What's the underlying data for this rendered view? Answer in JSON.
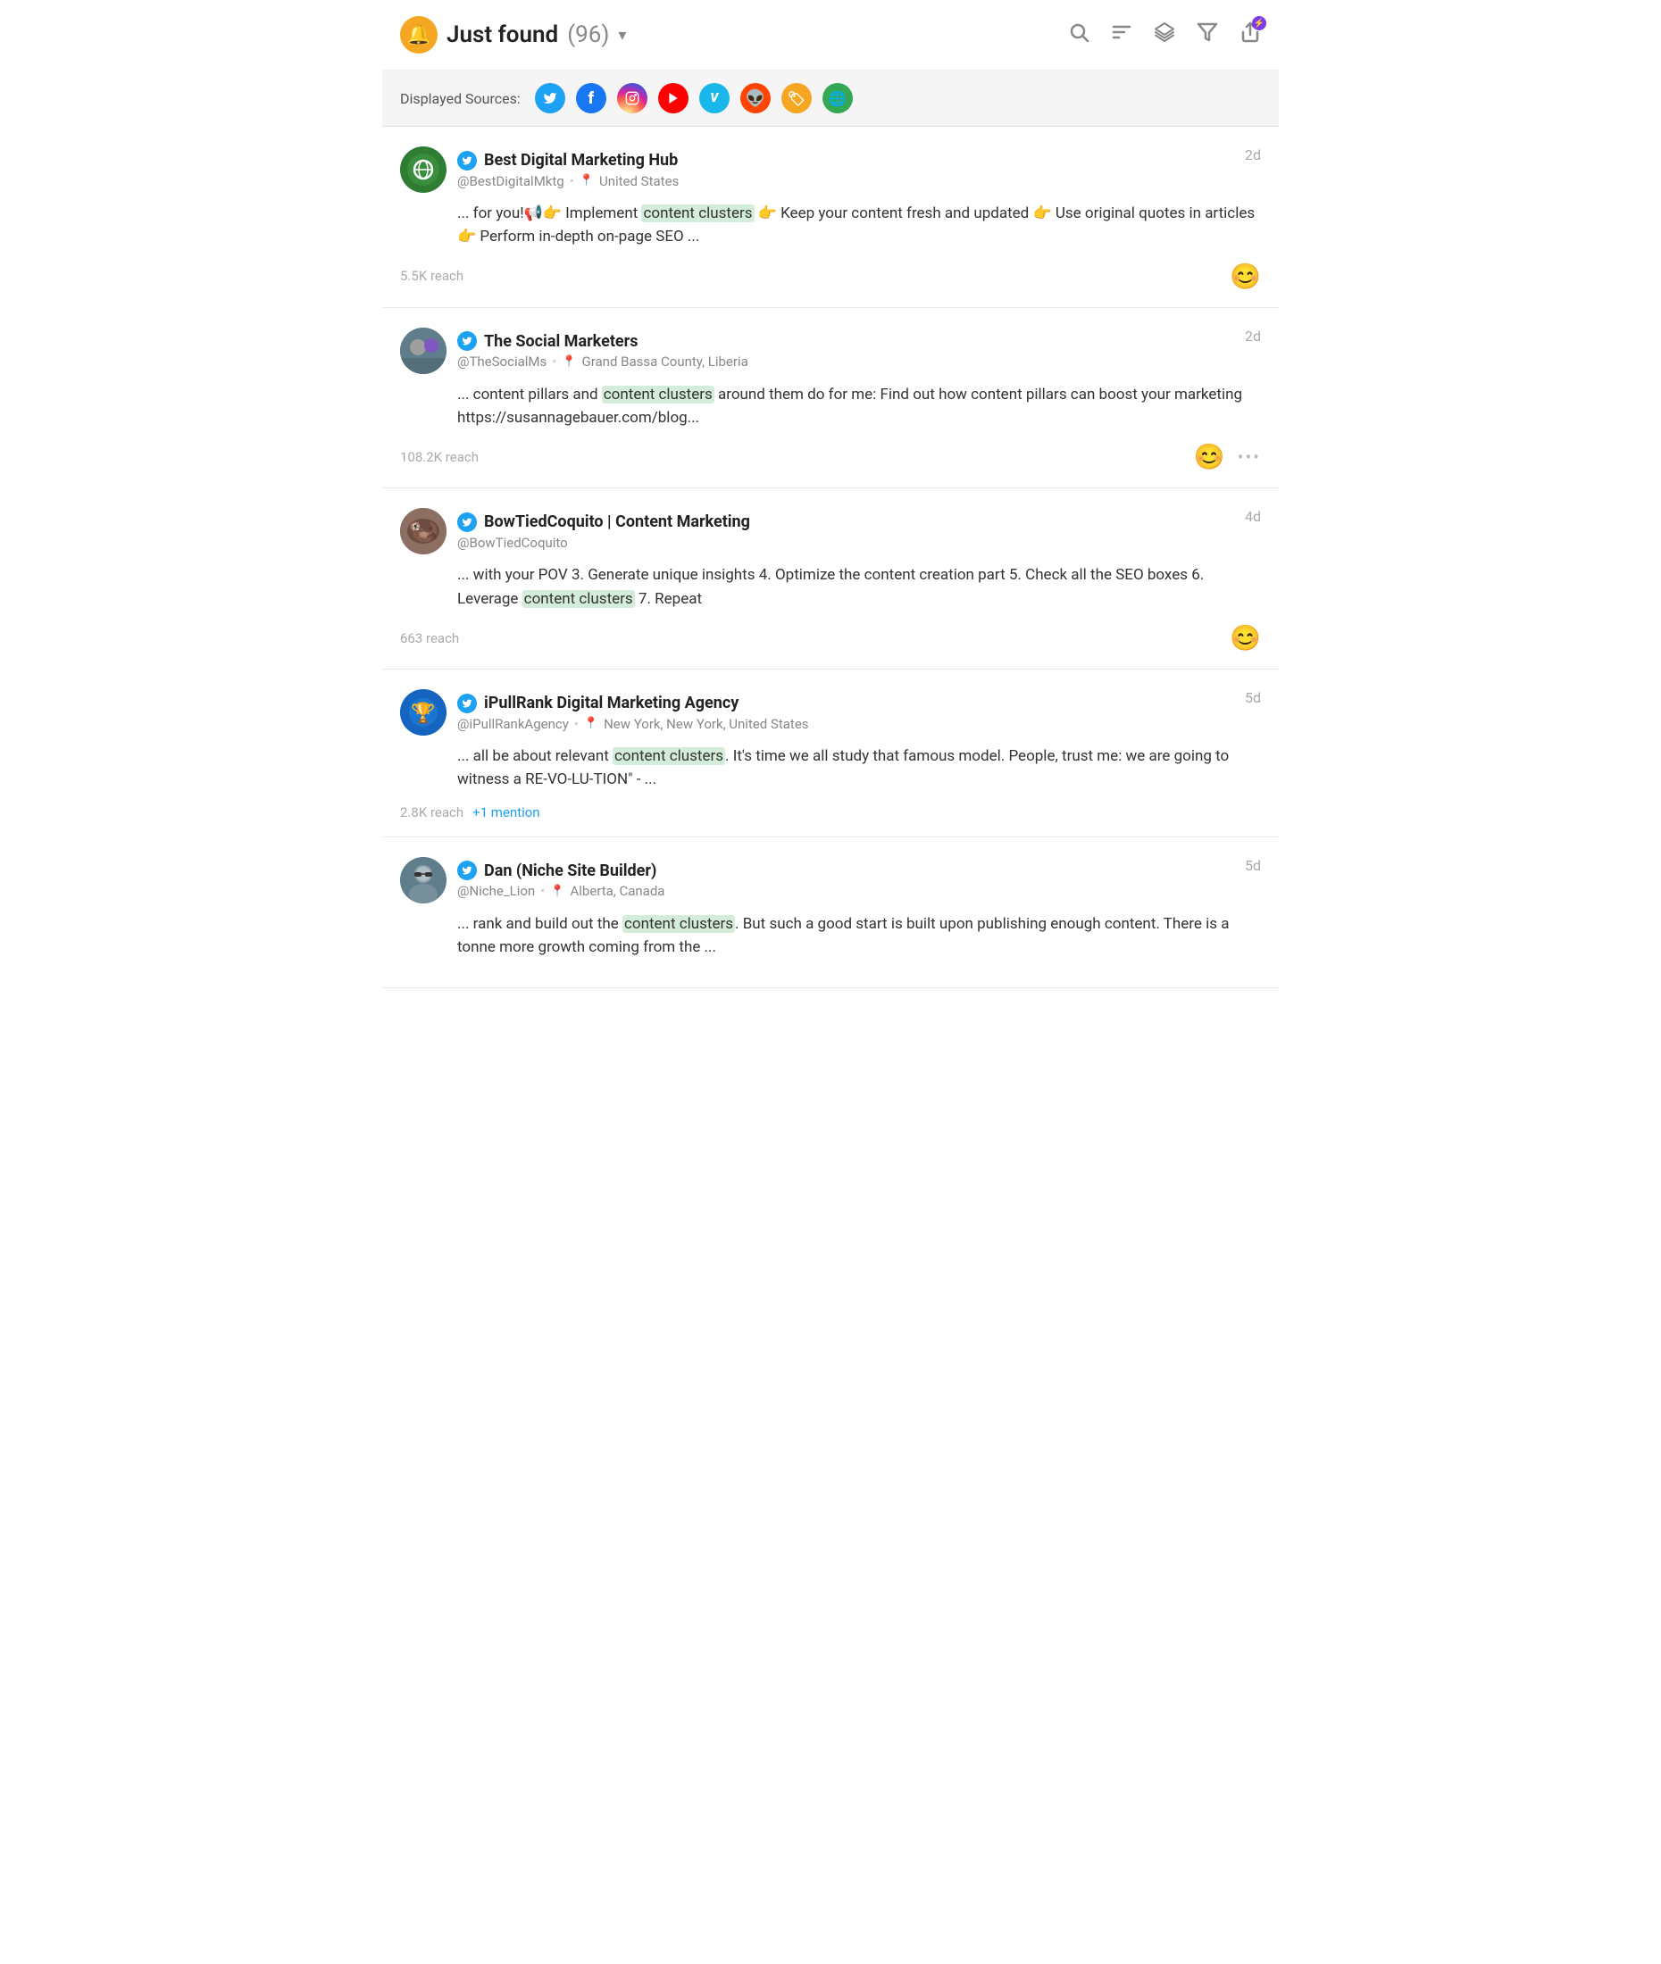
{
  "header": {
    "bell_label": "🔔",
    "title": "Just found",
    "count": "(96)",
    "dropdown": "▾",
    "actions": [
      {
        "name": "search-icon",
        "symbol": "🔍",
        "badge": null
      },
      {
        "name": "sort-icon",
        "symbol": "≡",
        "badge": null
      },
      {
        "name": "layers-icon",
        "symbol": "◈",
        "badge": null
      },
      {
        "name": "filter-icon",
        "symbol": "⋮",
        "badge": null
      },
      {
        "name": "share-icon",
        "symbol": "↑",
        "badge": "⚡"
      }
    ]
  },
  "sources": {
    "label": "Displayed Sources:",
    "items": [
      {
        "name": "twitter",
        "symbol": "🐦",
        "class": "source-twitter"
      },
      {
        "name": "facebook",
        "symbol": "f",
        "class": "source-facebook"
      },
      {
        "name": "instagram",
        "symbol": "📷",
        "class": "source-instagram"
      },
      {
        "name": "youtube",
        "symbol": "▶",
        "class": "source-youtube"
      },
      {
        "name": "vimeo",
        "symbol": "V",
        "class": "source-vimeo"
      },
      {
        "name": "reddit",
        "symbol": "👽",
        "class": "source-reddit"
      },
      {
        "name": "product",
        "symbol": "🏷",
        "class": "source-product"
      },
      {
        "name": "web",
        "symbol": "🌐",
        "class": "source-web"
      }
    ]
  },
  "posts": [
    {
      "id": "post-1",
      "avatar_initials": "🌐",
      "avatar_class": "avatar-digital",
      "author_name": "Best Digital Marketing Hub",
      "handle": "@BestDigitalMktg",
      "location": "United States",
      "time": "2d",
      "content_before": "... for you!📢👉 Implement ",
      "highlight": "content clusters",
      "content_after": " 👉 Keep your content fresh and updated 👉 Use original quotes in articles 👉 Perform in-depth on-page SEO ...",
      "reach": "5.5K reach",
      "sentiment": "😊",
      "extra_mention": null
    },
    {
      "id": "post-2",
      "avatar_initials": "👥",
      "avatar_class": "avatar-social",
      "author_name": "The Social Marketers",
      "handle": "@TheSocialMs",
      "location": "Grand Bassa County, Liberia",
      "time": "2d",
      "content_before": "... content pillars and ",
      "highlight": "content clusters",
      "content_after": " around them do for me: Find out how content pillars can boost your marketing https://susannagebauer.com/blog...",
      "reach": "108.2K reach",
      "sentiment": "😊",
      "extra_mention": null,
      "has_more": true
    },
    {
      "id": "post-3",
      "avatar_initials": "🦦",
      "avatar_class": "avatar-bowtied",
      "author_name": "BowTiedCoquito | Content Marketing",
      "handle": "@BowTiedCoquito",
      "location": null,
      "time": "4d",
      "content_before": "... with your POV 3. Generate unique insights 4. Optimize the content creation part 5. Check all the SEO boxes 6. Leverage ",
      "highlight": "content clusters",
      "content_after": " 7. Repeat",
      "reach": "663 reach",
      "sentiment": "😊",
      "extra_mention": null
    },
    {
      "id": "post-4",
      "avatar_initials": "🏆",
      "avatar_class": "avatar-ipull",
      "author_name": "iPullRank Digital Marketing Agency",
      "handle": "@iPullRankAgency",
      "location": "New York, New York, United States",
      "time": "5d",
      "content_before": "... all be about relevant ",
      "highlight": "content clusters",
      "content_after": ". It's time we all study that famous model. People, trust me: we are going to witness a RE-VO-LU-TION\" - ...",
      "reach": "2.8K reach",
      "sentiment": null,
      "extra_mention": "+1 mention"
    },
    {
      "id": "post-5",
      "avatar_initials": "🧑",
      "avatar_class": "avatar-dan",
      "author_name": "Dan (Niche Site Builder)",
      "handle": "@Niche_Lion",
      "location": "Alberta, Canada",
      "time": "5d",
      "content_before": "... rank and build out the ",
      "highlight": "content clusters",
      "content_after": ". But such a good start is built upon publishing enough content. There is a tonne more growth coming from the ...",
      "reach": null,
      "sentiment": null,
      "extra_mention": null
    }
  ]
}
